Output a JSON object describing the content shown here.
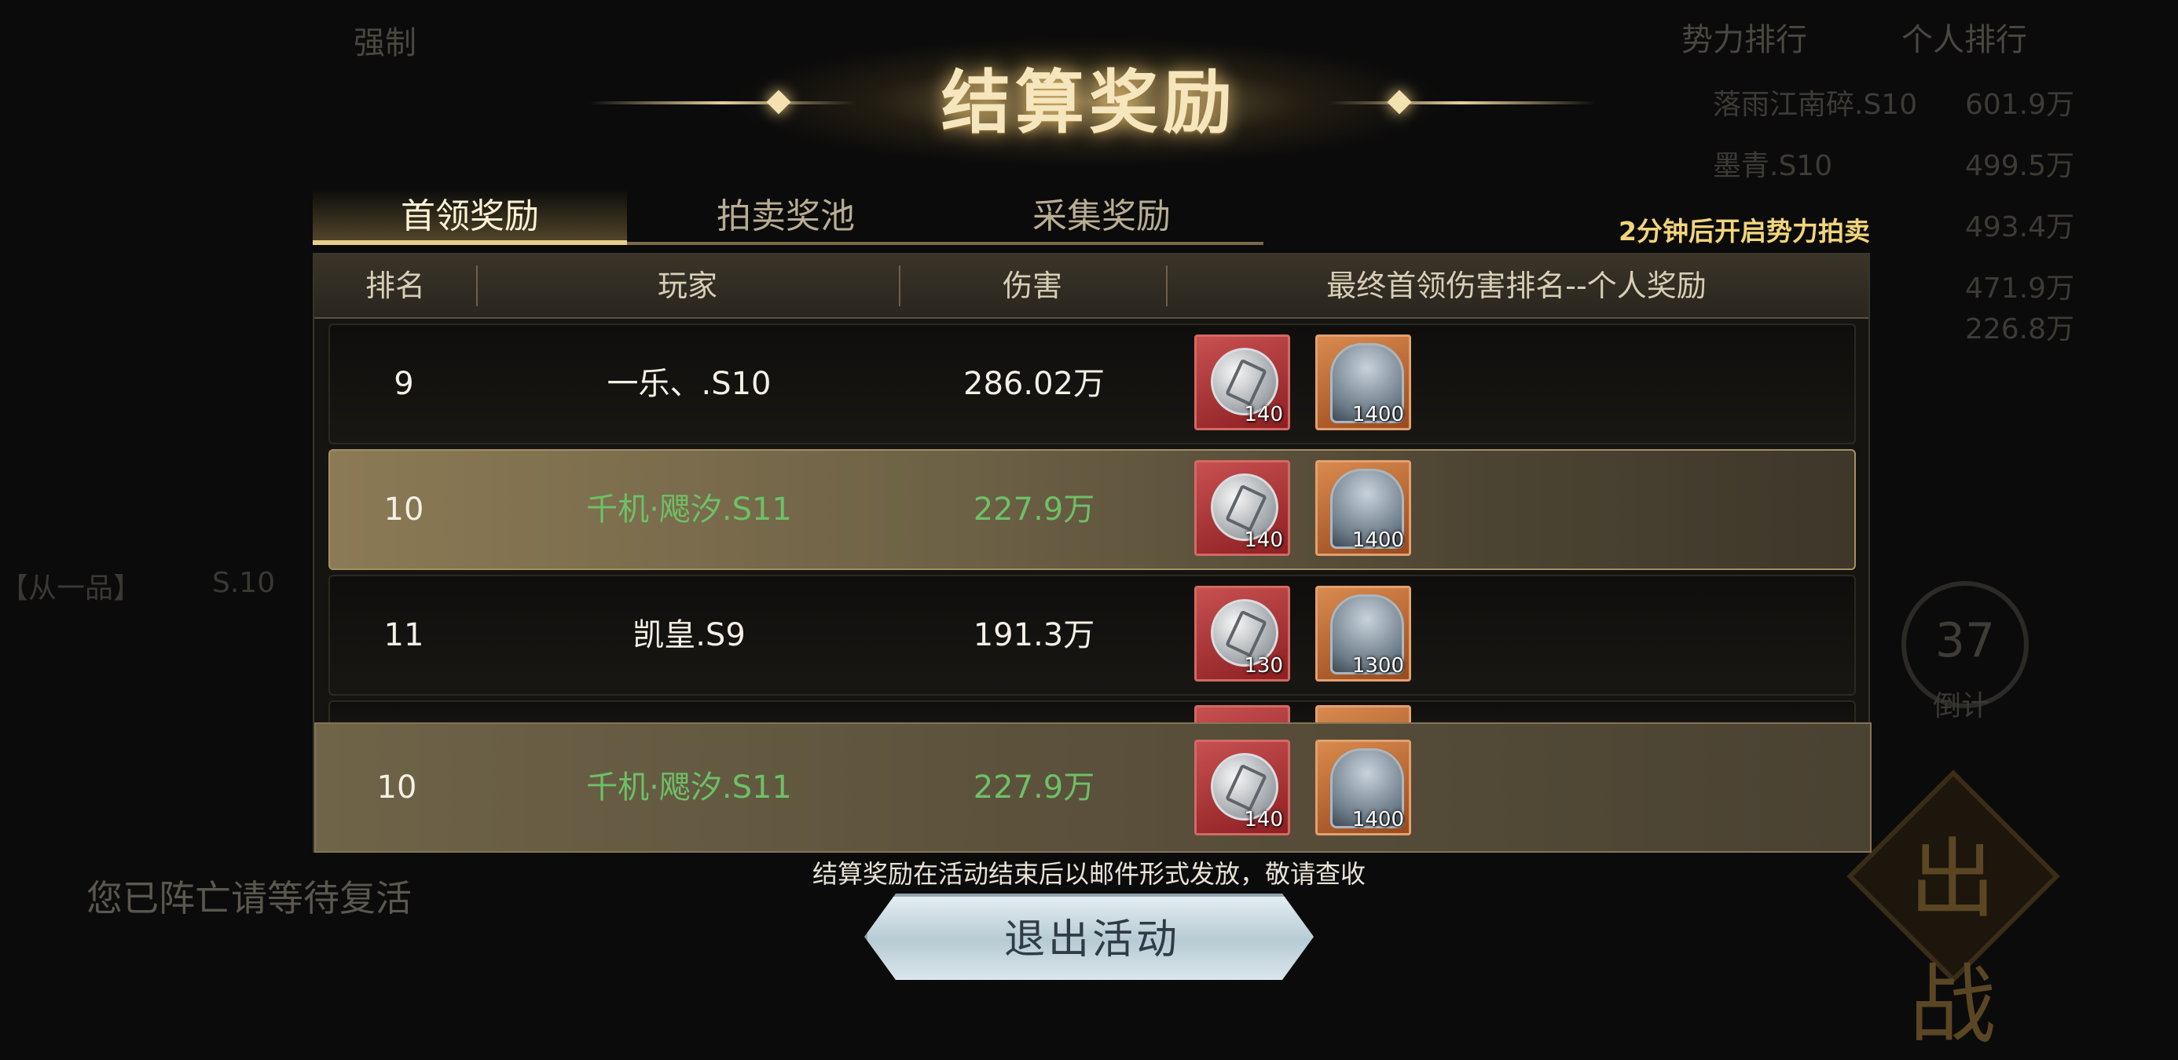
{
  "title": "结算奖励",
  "tabs": [
    {
      "label": "首领奖励",
      "active": true
    },
    {
      "label": "拍卖奖池",
      "active": false
    },
    {
      "label": "采集奖励",
      "active": false
    }
  ],
  "notice": "2分钟后开启势力拍卖",
  "table": {
    "headers": [
      "排名",
      "玩家",
      "伤害",
      "最终首领伤害排名--个人奖励"
    ],
    "rows": [
      {
        "rank": "9",
        "player": "一乐、.S10",
        "damage": "286.02万",
        "highlight": false,
        "rewards": [
          {
            "icon": "silver-token-icon",
            "qty": "140"
          },
          {
            "icon": "silver-chest-icon",
            "qty": "1400"
          }
        ]
      },
      {
        "rank": "10",
        "player": "千机·飔汐.S11",
        "damage": "227.9万",
        "highlight": true,
        "rewards": [
          {
            "icon": "silver-token-icon",
            "qty": "140"
          },
          {
            "icon": "silver-chest-icon",
            "qty": "1400"
          }
        ]
      },
      {
        "rank": "11",
        "player": "凯皇.S9",
        "damage": "191.3万",
        "highlight": false,
        "rewards": [
          {
            "icon": "silver-token-icon",
            "qty": "130"
          },
          {
            "icon": "silver-chest-icon",
            "qty": "1300"
          }
        ]
      }
    ],
    "self_row": {
      "rank": "10",
      "player": "千机·飔汐.S11",
      "damage": "227.9万",
      "rewards": [
        {
          "icon": "silver-token-icon",
          "qty": "140"
        },
        {
          "icon": "silver-chest-icon",
          "qty": "1400"
        }
      ]
    }
  },
  "footer_note": "结算奖励在活动结束后以邮件形式发放，敬请查收",
  "exit_button": "退出活动",
  "background": {
    "strong_label": "强制",
    "rank_tabs": [
      "势力排行",
      "个人排行"
    ],
    "rank_rows": [
      {
        "name": "落雨江南碎.S10",
        "value": "601.9万"
      },
      {
        "name": "墨青.S10",
        "value": "499.5万"
      },
      {
        "name": "",
        "value": "493.4万"
      },
      {
        "name": "",
        "value": "471.9万"
      },
      {
        "name": "",
        "value": "226.8万"
      }
    ],
    "status": "您已阵亡请等待复活",
    "countdown": "37",
    "countdown_label": "倒计",
    "side_label": "【从一品】",
    "side_server": "S.10",
    "dispatch_glyph": "出战"
  },
  "colors": {
    "highlight_text": "#6ec066",
    "notice": "#f2d47a",
    "title": "#f6e6bd"
  }
}
